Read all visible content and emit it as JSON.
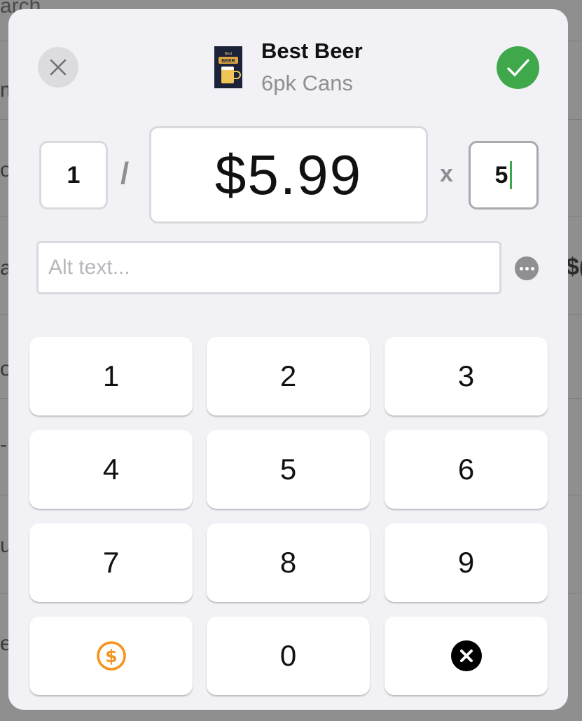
{
  "background": {
    "search_fragment": "arch",
    "row_fragments": [
      "m",
      "o",
      "a",
      "o",
      "-",
      "u",
      "e"
    ],
    "right_fragment": "$("
  },
  "header": {
    "product_title": "Best Beer",
    "product_subtitle": "6pk Cans",
    "thumb_small_text": "Best",
    "thumb_brand_text": "BEER"
  },
  "pricing": {
    "quantity": "1",
    "divider": "/",
    "price": "$5.99",
    "times": "x",
    "multiplier": "5"
  },
  "alt_text": {
    "value": "",
    "placeholder": "Alt text..."
  },
  "keypad": {
    "keys": [
      "1",
      "2",
      "3",
      "4",
      "5",
      "6",
      "7",
      "8",
      "9",
      "",
      "0",
      ""
    ]
  },
  "colors": {
    "confirm": "#3fa84a",
    "currency_icon": "#f7931e",
    "delete_icon": "#000000"
  },
  "icons": {
    "close": "close-icon",
    "confirm": "checkmark-icon",
    "more": "ellipsis-icon",
    "currency": "dollar-circle-icon",
    "delete": "delete-circle-icon"
  }
}
